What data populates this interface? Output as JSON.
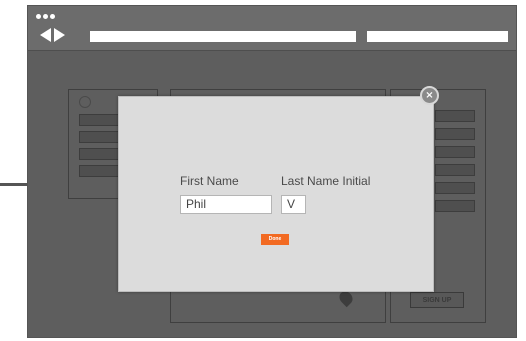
{
  "modal": {
    "first_name_label": "First Name",
    "last_name_label": "Last Name Initial",
    "first_name_value": "Phil",
    "last_name_value": "V",
    "done_label": "Done",
    "close_icon": "close-icon"
  },
  "background_page": {
    "signup_label": "SIGN UP"
  },
  "colors": {
    "accent": "#f26a22",
    "modal_bg": "#dcdcdc",
    "overlay": "#5e5e5e"
  }
}
